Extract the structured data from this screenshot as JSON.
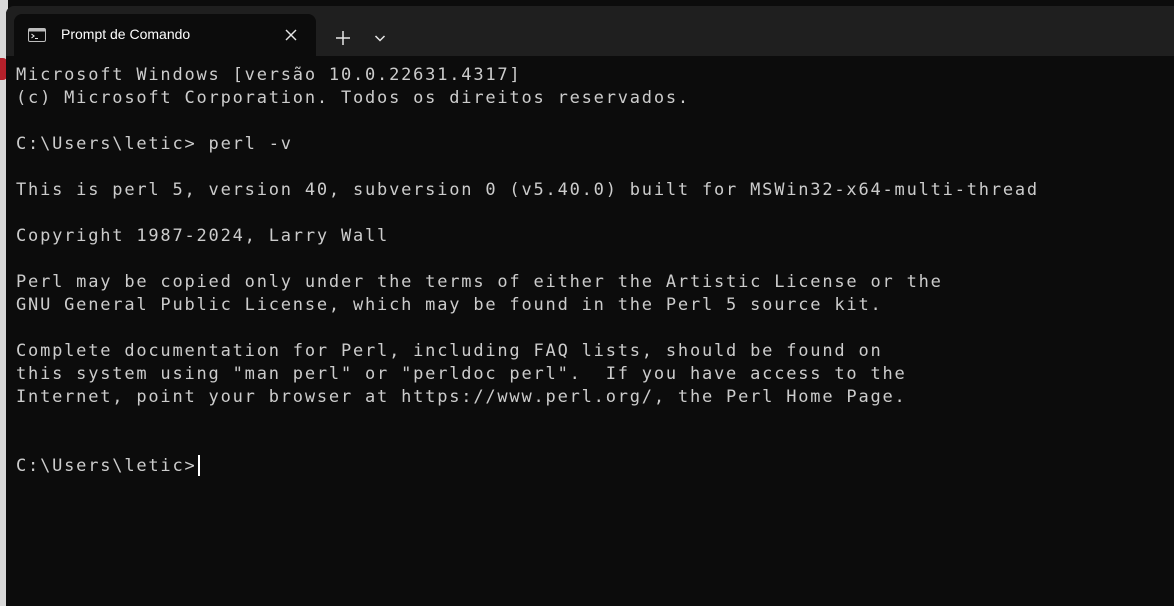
{
  "tab": {
    "title": "Prompt de Comando",
    "icon": "terminal-icon",
    "close_icon": "close-icon"
  },
  "toolbar": {
    "new_tab_icon": "plus-icon",
    "dropdown_icon": "chevron-down-icon"
  },
  "terminal": {
    "lines": [
      "Microsoft Windows [versão 10.0.22631.4317]",
      "(c) Microsoft Corporation. Todos os direitos reservados.",
      "",
      "C:\\Users\\letic> perl -v",
      "",
      "This is perl 5, version 40, subversion 0 (v5.40.0) built for MSWin32-x64-multi-thread",
      "",
      "Copyright 1987-2024, Larry Wall",
      "",
      "Perl may be copied only under the terms of either the Artistic License or the",
      "GNU General Public License, which may be found in the Perl 5 source kit.",
      "",
      "Complete documentation for Perl, including FAQ lists, should be found on",
      "this system using \"man perl\" or \"perldoc perl\".  If you have access to the",
      "Internet, point your browser at https://www.perl.org/, the Perl Home Page.",
      "",
      "",
      "C:\\Users\\letic>"
    ]
  },
  "colors": {
    "background": "#0c0c0c",
    "titlebar": "#1f1f1f",
    "text": "#cccccc",
    "tab_text": "#ffffff"
  }
}
